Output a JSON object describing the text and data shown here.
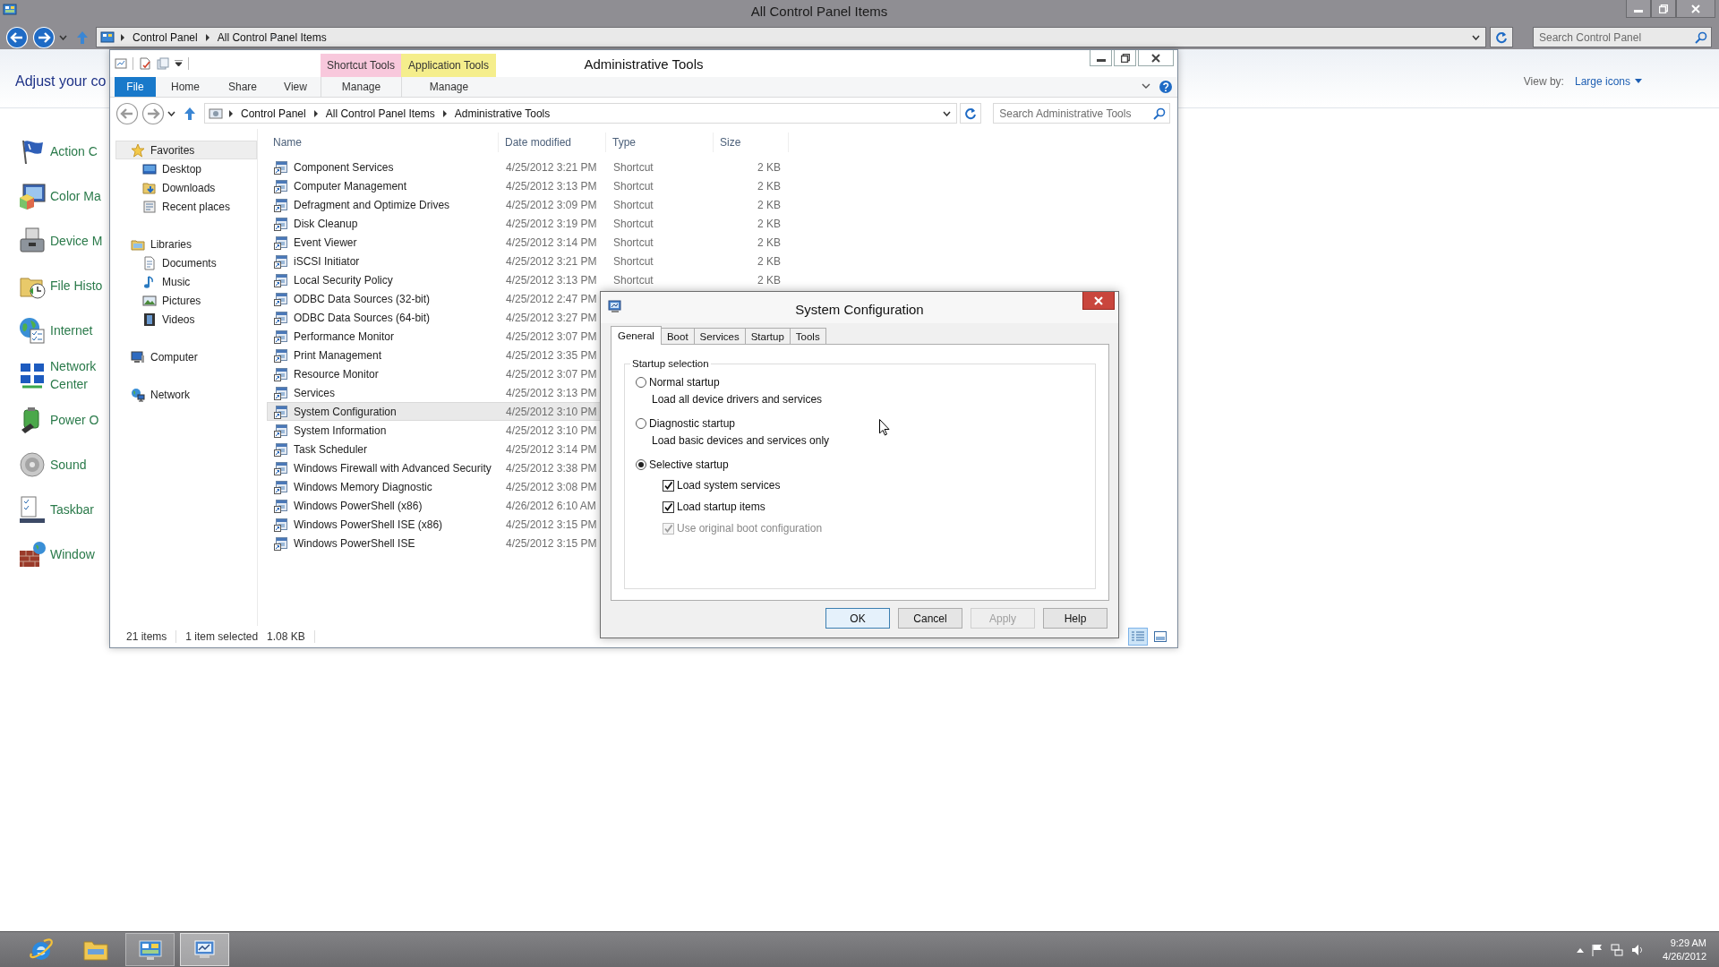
{
  "control_panel": {
    "title": "All Control Panel Items",
    "breadcrumb": [
      "Control Panel",
      "All Control Panel Items"
    ],
    "search": {
      "placeholder": "Search Control Panel"
    },
    "heading": "Adjust your co",
    "view_by": {
      "label": "View by:",
      "value": "Large icons"
    },
    "items": [
      {
        "kind": "flag",
        "lines": [
          "Action C"
        ]
      },
      {
        "kind": "color",
        "lines": [
          "Color Ma"
        ]
      },
      {
        "kind": "device",
        "lines": [
          "Device M"
        ]
      },
      {
        "kind": "history",
        "lines": [
          "File Histo"
        ]
      },
      {
        "kind": "internet",
        "lines": [
          "Internet"
        ]
      },
      {
        "kind": "network",
        "lines": [
          "Network",
          "Center"
        ]
      },
      {
        "kind": "power",
        "lines": [
          "Power O"
        ]
      },
      {
        "kind": "sound",
        "lines": [
          "Sound"
        ]
      },
      {
        "kind": "taskbar",
        "lines": [
          "Taskbar"
        ]
      },
      {
        "kind": "firewall",
        "lines": [
          "Window"
        ]
      }
    ]
  },
  "explorer": {
    "title": "Administrative Tools",
    "context_groups": [
      {
        "label": "Shortcut Tools",
        "color": "#f8c8dc",
        "tab": "Manage"
      },
      {
        "label": "Application Tools",
        "color": "#f5ee8c",
        "tab": "Manage"
      }
    ],
    "ribbon_tabs": [
      {
        "label": "File",
        "kind": "file"
      },
      {
        "label": "Home",
        "kind": "plain"
      },
      {
        "label": "Share",
        "kind": "plain"
      },
      {
        "label": "View",
        "kind": "plain"
      }
    ],
    "breadcrumb": [
      "Control Panel",
      "All Control Panel Items",
      "Administrative Tools"
    ],
    "search": {
      "placeholder": "Search Administrative Tools"
    },
    "nav": [
      {
        "label": "Favorites",
        "kind": "star",
        "selected": true,
        "children": [
          {
            "label": "Desktop",
            "kind": "desktop",
            "selected": false
          },
          {
            "label": "Downloads",
            "kind": "downloads",
            "selected": false
          },
          {
            "label": "Recent places",
            "kind": "recent",
            "selected": false
          }
        ]
      },
      {
        "label": "Libraries",
        "kind": "library",
        "selected": false,
        "children": [
          {
            "label": "Documents",
            "kind": "document",
            "selected": false
          },
          {
            "label": "Music",
            "kind": "music",
            "selected": false
          },
          {
            "label": "Pictures",
            "kind": "pictures",
            "selected": false
          },
          {
            "label": "Videos",
            "kind": "videos",
            "selected": false
          }
        ]
      },
      {
        "label": "Computer",
        "kind": "computer",
        "selected": false
      },
      {
        "label": "Network",
        "kind": "network",
        "selected": false
      }
    ],
    "columns": [
      "Name",
      "Date modified",
      "Type",
      "Size"
    ],
    "files": [
      {
        "name": "Component Services",
        "date": "4/25/2012 3:21 PM",
        "type": "Shortcut",
        "size": "2 KB",
        "selected": false
      },
      {
        "name": "Computer Management",
        "date": "4/25/2012 3:13 PM",
        "type": "Shortcut",
        "size": "2 KB",
        "selected": false
      },
      {
        "name": "Defragment and Optimize Drives",
        "date": "4/25/2012 3:09 PM",
        "type": "Shortcut",
        "size": "2 KB",
        "selected": false
      },
      {
        "name": "Disk Cleanup",
        "date": "4/25/2012 3:19 PM",
        "type": "Shortcut",
        "size": "2 KB",
        "selected": false
      },
      {
        "name": "Event Viewer",
        "date": "4/25/2012 3:14 PM",
        "type": "Shortcut",
        "size": "2 KB",
        "selected": false
      },
      {
        "name": "iSCSI Initiator",
        "date": "4/25/2012 3:21 PM",
        "type": "Shortcut",
        "size": "2 KB",
        "selected": false
      },
      {
        "name": "Local Security Policy",
        "date": "4/25/2012 3:13 PM",
        "type": "Shortcut",
        "size": "2 KB",
        "selected": false
      },
      {
        "name": "ODBC Data Sources (32-bit)",
        "date": "4/25/2012 2:47 PM",
        "selected": false
      },
      {
        "name": "ODBC Data Sources (64-bit)",
        "date": "4/25/2012 3:27 PM",
        "selected": false
      },
      {
        "name": "Performance Monitor",
        "date": "4/25/2012 3:07 PM",
        "selected": false
      },
      {
        "name": "Print Management",
        "date": "4/25/2012 3:35 PM",
        "selected": false
      },
      {
        "name": "Resource Monitor",
        "date": "4/25/2012 3:07 PM",
        "selected": false
      },
      {
        "name": "Services",
        "date": "4/25/2012 3:13 PM",
        "selected": false
      },
      {
        "name": "System Configuration",
        "date": "4/25/2012 3:10 PM",
        "selected": true
      },
      {
        "name": "System Information",
        "date": "4/25/2012 3:10 PM",
        "selected": false
      },
      {
        "name": "Task Scheduler",
        "date": "4/25/2012 3:14 PM",
        "selected": false
      },
      {
        "name": "Windows Firewall with Advanced Security",
        "date": "4/25/2012 3:38 PM",
        "selected": false
      },
      {
        "name": "Windows Memory Diagnostic",
        "date": "4/25/2012 3:08 PM",
        "selected": false
      },
      {
        "name": "Windows PowerShell (x86)",
        "date": "4/26/2012 6:10 AM",
        "selected": false
      },
      {
        "name": "Windows PowerShell ISE (x86)",
        "date": "4/25/2012 3:15 PM",
        "selected": false
      },
      {
        "name": "Windows PowerShell ISE",
        "date": "4/25/2012 3:15 PM",
        "selected": false
      }
    ],
    "status": {
      "count": "21 items",
      "selection": "1 item selected",
      "size": "1.08 KB"
    },
    "views": [
      {
        "kind": "details",
        "selected": true
      },
      {
        "kind": "large_icons",
        "selected": false
      }
    ]
  },
  "dialog": {
    "title": "System Configuration",
    "tabs": [
      {
        "label": "General",
        "selected": true
      },
      {
        "label": "Boot",
        "selected": false
      },
      {
        "label": "Services",
        "selected": false
      },
      {
        "label": "Startup",
        "selected": false
      },
      {
        "label": "Tools",
        "selected": false
      }
    ],
    "group": "Startup selection",
    "options": [
      {
        "label": "Normal startup",
        "description": "Load all device drivers and services",
        "selected": false
      },
      {
        "label": "Diagnostic startup",
        "description": "Load basic devices and services only",
        "selected": false
      },
      {
        "label": "Selective startup",
        "selected": true,
        "checks": [
          {
            "label": "Load system services",
            "checked": true,
            "disabled": false
          },
          {
            "label": "Load startup items",
            "checked": true,
            "disabled": false
          },
          {
            "label": "Use original boot configuration",
            "checked": true,
            "disabled": true
          }
        ]
      }
    ],
    "buttons": [
      {
        "label": "OK",
        "default": true,
        "disabled": false
      },
      {
        "label": "Cancel",
        "default": false,
        "disabled": false
      },
      {
        "label": "Apply",
        "default": false,
        "disabled": true
      },
      {
        "label": "Help",
        "default": false,
        "disabled": false
      }
    ]
  },
  "taskbar": {
    "apps": [
      {
        "kind": "ie",
        "running": false,
        "focused": false
      },
      {
        "kind": "explorer",
        "running": false,
        "focused": false
      },
      {
        "kind": "control_panel",
        "running": true,
        "focused": false
      },
      {
        "kind": "msconfig",
        "running": true,
        "focused": true
      }
    ],
    "time": "9:29 AM",
    "date": "4/26/2012"
  }
}
